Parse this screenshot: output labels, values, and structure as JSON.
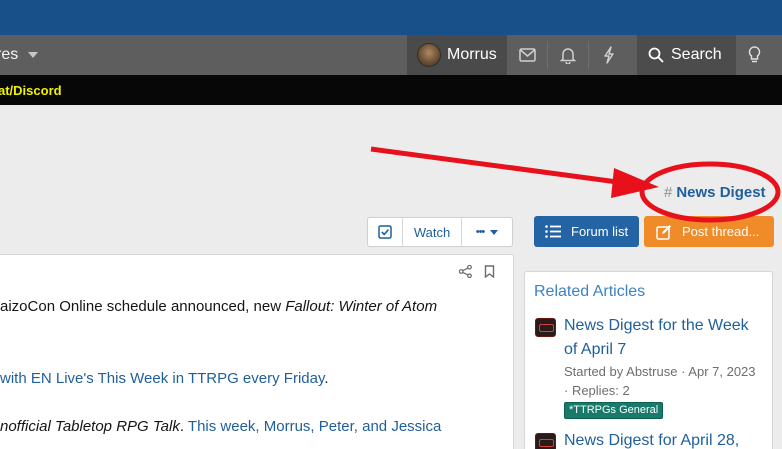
{
  "navbar": {
    "left_label": "res",
    "user_name": "Morrus",
    "search_label": "Search",
    "icons": [
      "mail-icon",
      "bell-icon",
      "lightning-icon",
      "search-icon",
      "lightbulb-icon"
    ]
  },
  "notice_bar": {
    "link": "at/Discord"
  },
  "tag": {
    "hash": "#",
    "label": "News Digest"
  },
  "thread_actions": {
    "watch": "Watch",
    "more": "•••"
  },
  "buttons": {
    "forum_list": "Forum list",
    "post_thread": "Post thread..."
  },
  "post": {
    "line1_a": "aizoCon Online schedule announced, new ",
    "line1_b": "Fallout: Winter of Atom",
    "line2_a": "with EN Live's This Week in TTRPG every Friday",
    "line2_b": ".",
    "line3_a": "nofficial Tabletop RPG Talk",
    "line3_b": ". ",
    "line3_c": "This week, Morrus, Peter, and Jessica"
  },
  "sidebar": {
    "title": "Related Articles",
    "articles": [
      {
        "title_line1": "News Digest for the Week",
        "title_line2": "of April 7",
        "meta_line1": "Started by Abstruse · Apr 7, 2023",
        "meta_line2": "· Replies: 2",
        "tag": "*TTRPGs General"
      },
      {
        "title_line1": "News Digest for April 28,"
      }
    ]
  },
  "colors": {
    "topbar": "#185089",
    "navbar": "#5e5e5e",
    "link": "#1f5f9b",
    "notice_text": "#f1f100",
    "forum_button": "#2464a4",
    "post_button": "#f08b2a",
    "annotation": "#e8101b",
    "tag_bg": "#177a6a"
  }
}
